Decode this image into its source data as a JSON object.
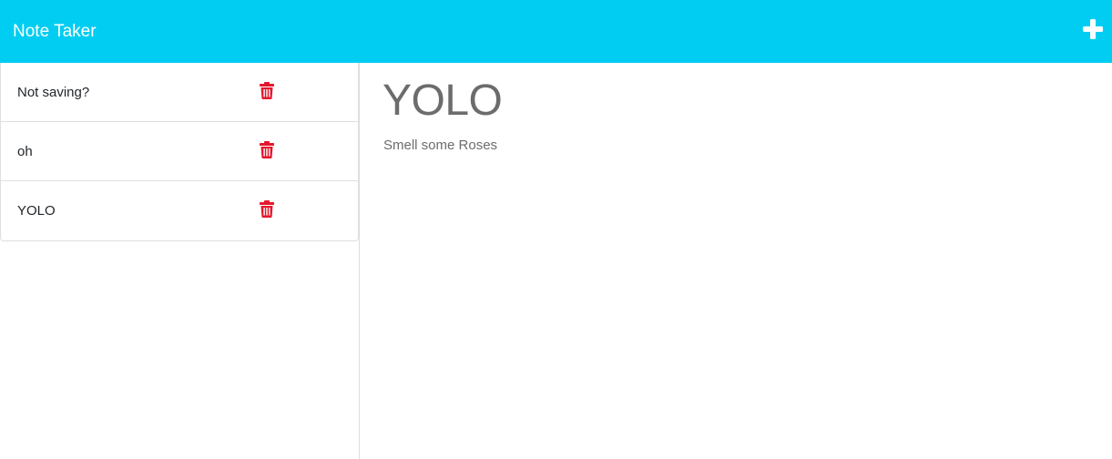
{
  "navbar": {
    "brand": "Note Taker",
    "new_note_icon": "plus-icon"
  },
  "notes": [
    {
      "title": "Not saving?",
      "delete_icon": "trash-icon"
    },
    {
      "title": "oh",
      "delete_icon": "trash-icon"
    },
    {
      "title": "YOLO",
      "delete_icon": "trash-icon"
    }
  ],
  "active_note": {
    "title": "YOLO",
    "text": "Smell some Roses"
  },
  "colors": {
    "navbar_bg": "#00cdf1",
    "delete": "#e4172c",
    "note_text": "#6c6c6c"
  }
}
